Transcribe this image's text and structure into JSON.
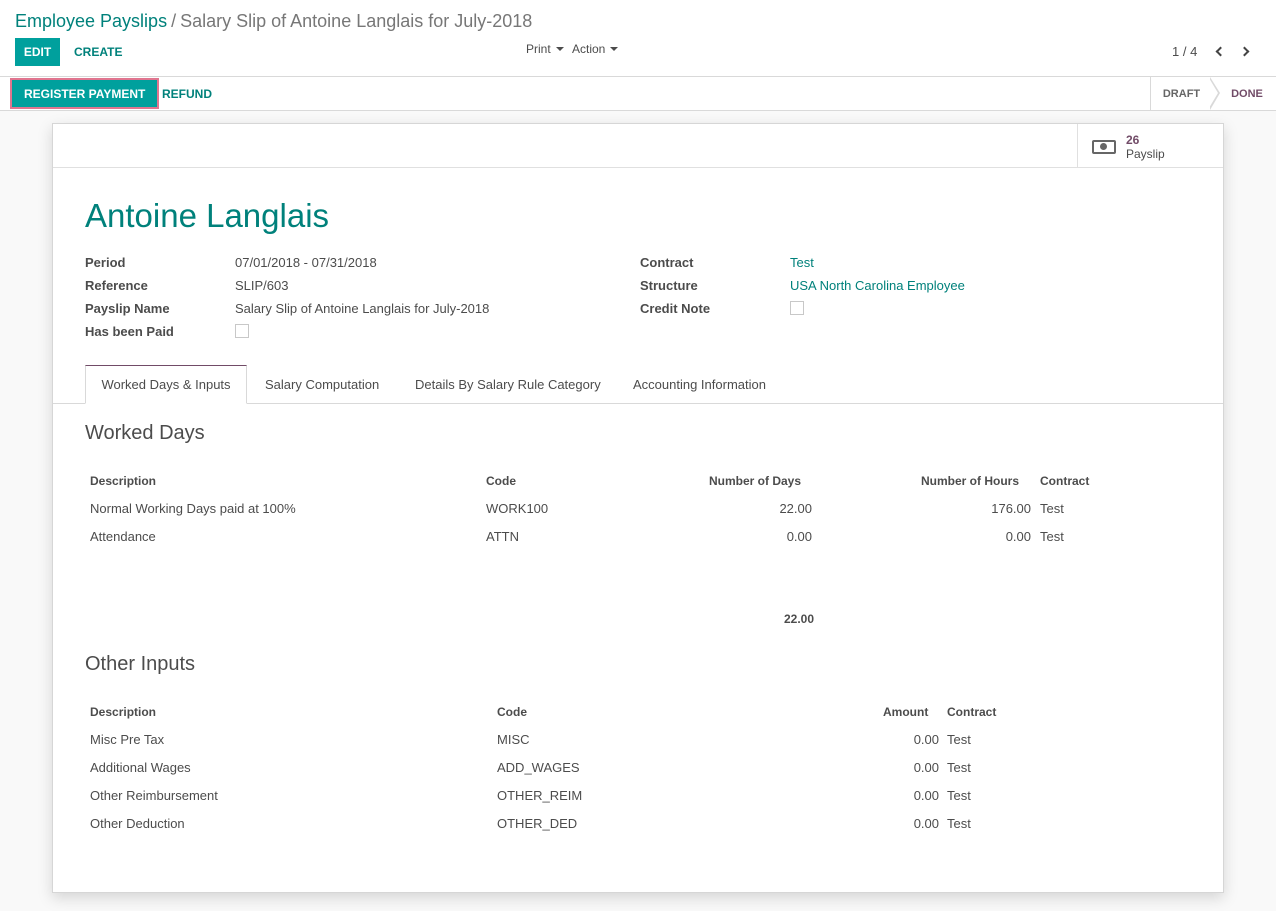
{
  "breadcrumb": {
    "parent": "Employee Payslips",
    "separator": "/",
    "current": "Salary Slip of Antoine Langlais for July-2018"
  },
  "toolbar": {
    "edit_label": "EDIT",
    "create_label": "CREATE",
    "print_label": "Print",
    "action_label": "Action"
  },
  "pager": {
    "value": "1 / 4"
  },
  "statusbar": {
    "register_payment_label": "REGISTER PAYMENT",
    "refund_label": "REFUND",
    "stages": [
      "DRAFT",
      "DONE"
    ],
    "active_stage": "DONE"
  },
  "smart_button": {
    "value": "26",
    "label": "Payslip",
    "icon": "money-icon"
  },
  "employee": {
    "name": "Antoine Langlais"
  },
  "fields_left": [
    {
      "label": "Period",
      "value": "07/01/2018 - 07/31/2018"
    },
    {
      "label": "Reference",
      "value": "SLIP/603"
    },
    {
      "label": "Payslip Name",
      "value": "Salary Slip of Antoine Langlais for July-2018"
    },
    {
      "label": "Has been Paid",
      "checked": false
    }
  ],
  "fields_right": [
    {
      "label": "Contract",
      "value": "Test"
    },
    {
      "label": "Structure",
      "value": "USA North Carolina Employee"
    },
    {
      "label": "Credit Note",
      "checked": false
    }
  ],
  "tabs": [
    {
      "label": "Worked Days & Inputs",
      "active": true
    },
    {
      "label": "Salary Computation"
    },
    {
      "label": "Details By Salary Rule Category"
    },
    {
      "label": "Accounting Information"
    }
  ],
  "worked_days": {
    "title": "Worked Days",
    "columns": [
      "Description",
      "Code",
      "Number of Days",
      "Number of Hours",
      "Contract"
    ],
    "rows": [
      [
        "Normal Working Days paid at 100%",
        "WORK100",
        "22.00",
        "176.00",
        "Test"
      ],
      [
        "Attendance",
        "ATTN",
        "0.00",
        "0.00",
        "Test"
      ]
    ],
    "total_days": "22.00"
  },
  "other_inputs": {
    "title": "Other Inputs",
    "columns": [
      "Description",
      "Code",
      "Amount",
      "Contract"
    ],
    "rows": [
      [
        "Misc Pre Tax",
        "MISC",
        "0.00",
        "Test"
      ],
      [
        "Additional Wages",
        "ADD_WAGES",
        "0.00",
        "Test"
      ],
      [
        "Other Reimbursement",
        "OTHER_REIM",
        "0.00",
        "Test"
      ],
      [
        "Other Deduction",
        "OTHER_DED",
        "0.00",
        "Test"
      ]
    ]
  },
  "colors": {
    "primary": "#00a09d",
    "link": "#00817b",
    "accent": "#714b67",
    "highlight_outline": "#e0758f"
  }
}
